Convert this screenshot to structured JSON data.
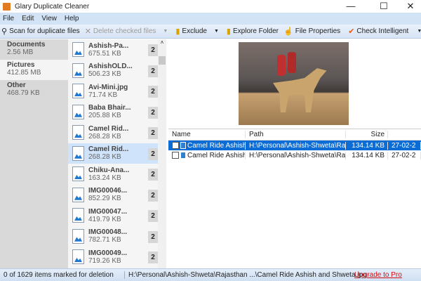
{
  "window": {
    "title": "Glary Duplicate Cleaner",
    "minimize": "—",
    "maximize": "☐",
    "close": "✕"
  },
  "menu": [
    "File",
    "Edit",
    "View",
    "Help"
  ],
  "toolbar": {
    "scan": "Scan for duplicate files",
    "delete": "Delete checked files",
    "exclude": "Exclude",
    "explore": "Explore Folder",
    "properties": "File Properties",
    "check": "Check Intelligent"
  },
  "categories": [
    {
      "name": "Documents",
      "size": "2.56 MB"
    },
    {
      "name": "Pictures",
      "size": "412.85 MB"
    },
    {
      "name": "Other",
      "size": "468.79 KB"
    }
  ],
  "files": [
    {
      "name": "Ashish-Pa...",
      "size": "675.51 KB",
      "count": "2"
    },
    {
      "name": "AshishOLD...",
      "size": "506.23 KB",
      "count": "2"
    },
    {
      "name": "Avi-Mini.jpg",
      "size": "71.74 KB",
      "count": "2"
    },
    {
      "name": "Baba Bhair...",
      "size": "205.88 KB",
      "count": "2"
    },
    {
      "name": "Camel Rid...",
      "size": "268.28 KB",
      "count": "2"
    },
    {
      "name": "Camel Rid...",
      "size": "268.28 KB",
      "count": "2"
    },
    {
      "name": "Chiku-Ana...",
      "size": "163.24 KB",
      "count": "2"
    },
    {
      "name": "IMG00046...",
      "size": "852.29 KB",
      "count": "2"
    },
    {
      "name": "IMG00047...",
      "size": "419.79 KB",
      "count": "2"
    },
    {
      "name": "IMG00048...",
      "size": "782.71 KB",
      "count": "2"
    },
    {
      "name": "IMG00049...",
      "size": "719.26 KB",
      "count": "2"
    }
  ],
  "table": {
    "headers": [
      "Name",
      "Path",
      "Size",
      ""
    ],
    "rows": [
      {
        "name": "Camel Ride Ashish ...",
        "path": "H:\\Personal\\Ashish-Shweta\\Raj...",
        "size": "134.14 KB",
        "date": "27-02-2"
      },
      {
        "name": "Camel Ride Ashish ...",
        "path": "H:\\Personal\\Ashish-Shweta\\Raj...",
        "size": "134.14 KB",
        "date": "27-02-2"
      }
    ]
  },
  "status": {
    "count": "0 of 1629 items marked for deletion",
    "path": "H:\\Personal\\Ashish-Shweta\\Rajasthan ...\\Camel Ride Ashish and Shweta.jpg",
    "upgrade": "Upgrade to Pro"
  }
}
